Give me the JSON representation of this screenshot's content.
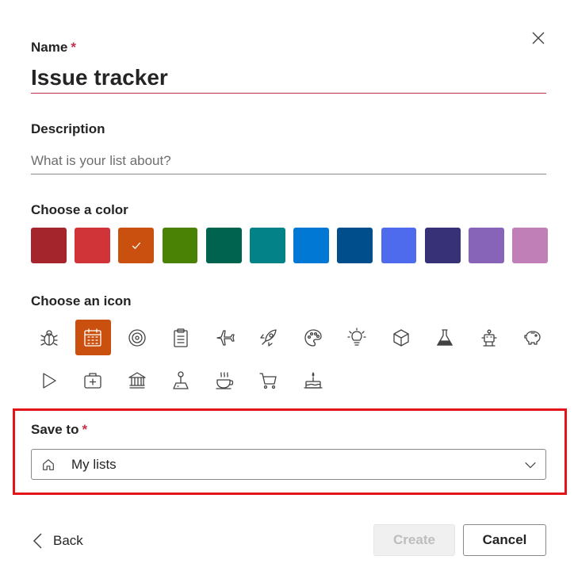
{
  "dialog": {
    "close_icon": "close-icon",
    "name": {
      "label": "Name",
      "required_marker": "*",
      "value": "Issue tracker"
    },
    "description": {
      "label": "Description",
      "placeholder": "What is your list about?",
      "value": ""
    },
    "color": {
      "label": "Choose a color",
      "selected_index": 2,
      "swatches": [
        "#a4262c",
        "#d13438",
        "#ca5010",
        "#498205",
        "#00634f",
        "#038387",
        "#0078d4",
        "#004e8c",
        "#4f6bed",
        "#373277",
        "#8764b8",
        "#c17fb8"
      ]
    },
    "icon": {
      "label": "Choose an icon",
      "selected": "calendar-icon",
      "icons": [
        "bug-icon",
        "calendar-icon",
        "target-icon",
        "clipboard-icon",
        "airplane-icon",
        "rocket-icon",
        "palette-icon",
        "lightbulb-icon",
        "cube-icon",
        "flask-icon",
        "robot-icon",
        "piggy-bank-icon",
        "play-icon",
        "first-aid-kit-icon",
        "bank-icon",
        "joystick-icon",
        "coffee-cup-icon",
        "shopping-cart-icon",
        "cake-icon"
      ]
    },
    "save_to": {
      "label": "Save to",
      "required_marker": "*",
      "value": "My lists",
      "icon": "home-icon"
    },
    "footer": {
      "back_label": "Back",
      "create_label": "Create",
      "cancel_label": "Cancel"
    },
    "accent_color": "#ca5010",
    "error_color": "#c4314b",
    "highlight_color": "#e3151a"
  }
}
